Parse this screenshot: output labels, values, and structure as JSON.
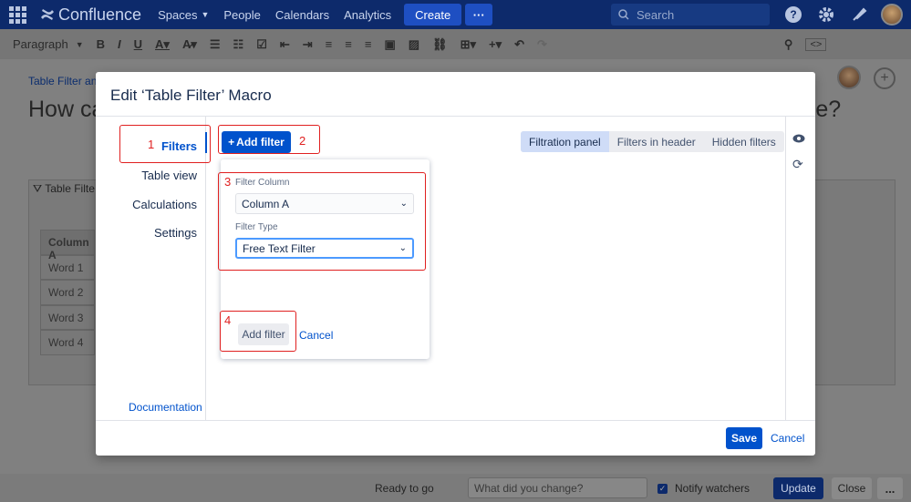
{
  "topnav": {
    "product": "Confluence",
    "items": [
      "Spaces",
      "People",
      "Calendars",
      "Analytics"
    ],
    "create_label": "Create",
    "more_label": "···",
    "search_placeholder": "Search"
  },
  "toolbar": {
    "paragraph_label": "Paragraph"
  },
  "page": {
    "breadcrumb": "Table Filter and",
    "title_start": "How ca",
    "title_end": "nce?",
    "macro_label": "Table Filte",
    "table": {
      "header": "Column A",
      "rows": [
        "Word 1",
        "Word 2",
        "Word 3",
        "Word 4"
      ]
    }
  },
  "bottombar": {
    "status": "Ready to go",
    "change_placeholder": "What did you change?",
    "notify_label": "Notify watchers",
    "update_label": "Update",
    "close_label": "Close",
    "more_label": "..."
  },
  "modal": {
    "title": "Edit ‘Table Filter’ Macro",
    "sidebar": [
      "Filters",
      "Table view",
      "Calculations",
      "Settings"
    ],
    "documentation": "Documentation",
    "add_filter_label": "Add filter",
    "segments": [
      "Filtration panel",
      "Filters in header",
      "Hidden filters"
    ],
    "popup": {
      "column_label": "Filter Column",
      "column_value": "Column A",
      "type_label": "Filter Type",
      "type_value": "Free Text Filter",
      "add_label": "Add filter",
      "cancel_label": "Cancel"
    },
    "save_label": "Save",
    "cancel_label": "Cancel"
  },
  "annotations": [
    "1",
    "2",
    "3",
    "4"
  ],
  "colors": {
    "accent": "#0052cc",
    "nav_bg": "#0d2a6b",
    "annotation": "#e02020"
  }
}
